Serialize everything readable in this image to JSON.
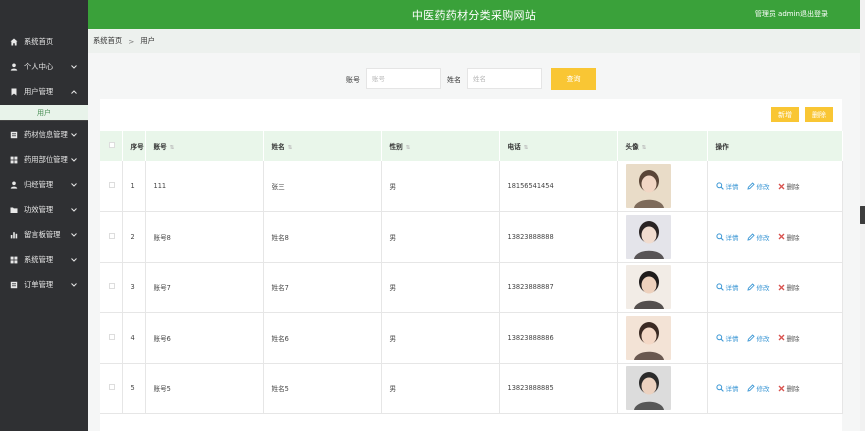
{
  "header": {
    "title": "中医药药材分类采购网站",
    "user_label": "管理员 admin",
    "logout_label": "退出登录"
  },
  "sidebar": {
    "items": [
      {
        "label": "系统首页",
        "icon": "home-icon",
        "expandable": false
      },
      {
        "label": "个人中心",
        "icon": "person-icon",
        "expandable": true
      },
      {
        "label": "用户管理",
        "icon": "bookmark-icon",
        "expandable": true,
        "expanded": true
      },
      {
        "label": "药材信息管理",
        "icon": "list-icon",
        "expandable": true
      },
      {
        "label": "药用部位管理",
        "icon": "grid-icon",
        "expandable": true
      },
      {
        "label": "归经管理",
        "icon": "person-icon",
        "expandable": true
      },
      {
        "label": "功效管理",
        "icon": "folder-icon",
        "expandable": true
      },
      {
        "label": "留言板管理",
        "icon": "chart-icon",
        "expandable": true
      },
      {
        "label": "系统管理",
        "icon": "grid-icon",
        "expandable": true
      },
      {
        "label": "订单管理",
        "icon": "list-icon",
        "expandable": true
      }
    ],
    "active_sub": "用户"
  },
  "breadcrumb": {
    "home": "系统首页",
    "separator": ">",
    "current": "用户"
  },
  "search": {
    "account_label": "账号",
    "account_placeholder": "账号",
    "name_label": "姓名",
    "name_placeholder": "姓名",
    "query_button": "查询"
  },
  "toolbar": {
    "add_label": "新增",
    "delete_label": "删除"
  },
  "table": {
    "columns": [
      "序号",
      "账号",
      "姓名",
      "性别",
      "电话",
      "头像",
      "操作"
    ],
    "rows": [
      {
        "index": "1",
        "account": "111",
        "name": "张三",
        "gender": "男",
        "phone": "18156541454"
      },
      {
        "index": "2",
        "account": "账号8",
        "name": "姓名8",
        "gender": "男",
        "phone": "13823888888"
      },
      {
        "index": "3",
        "account": "账号7",
        "name": "姓名7",
        "gender": "男",
        "phone": "13823888887"
      },
      {
        "index": "4",
        "account": "账号6",
        "name": "姓名6",
        "gender": "男",
        "phone": "13823888886"
      },
      {
        "index": "5",
        "account": "账号5",
        "name": "姓名5",
        "gender": "男",
        "phone": "13823888885"
      }
    ],
    "actions": {
      "view": "详情",
      "edit": "修改",
      "delete": "删除"
    }
  },
  "colors": {
    "header_green": "#3aa13a",
    "sidebar_bg": "#2f3033",
    "button_yellow": "#f9c634",
    "table_header_bg": "#e9f6ea"
  }
}
